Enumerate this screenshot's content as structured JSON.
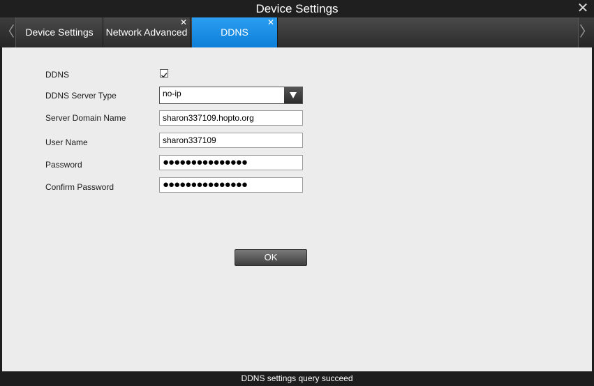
{
  "window": {
    "title": "Device Settings",
    "close_glyph": "✕"
  },
  "tabs": {
    "prev_glyph": "〈",
    "next_glyph": "〉",
    "items": [
      {
        "label": "Device Settings",
        "closable": false,
        "active": false
      },
      {
        "label": "Network Advanced",
        "closable": true,
        "active": false,
        "close_glyph": "✕"
      },
      {
        "label": "DDNS",
        "closable": true,
        "active": true,
        "close_glyph": "✕"
      }
    ]
  },
  "form": {
    "ddns_label": "DDNS",
    "ddns_enabled": true,
    "server_type_label": "DDNS Server Type",
    "server_type_value": "no-ip",
    "domain_label": "Server Domain Name",
    "domain_value": "sharon337109.hopto.org",
    "username_label": "User Name",
    "username_value": "sharon337109",
    "password_label": "Password",
    "password_value": "●●●●●●●●●●●●●●●",
    "confirm_label": "Confirm Password",
    "confirm_value": "●●●●●●●●●●●●●●●"
  },
  "actions": {
    "ok_label": "OK"
  },
  "status": {
    "message": "DDNS settings query succeed"
  },
  "colors": {
    "active_tab": "#1a8fe8",
    "content_bg": "#ececec",
    "chrome_bg": "#1d1d1d"
  }
}
